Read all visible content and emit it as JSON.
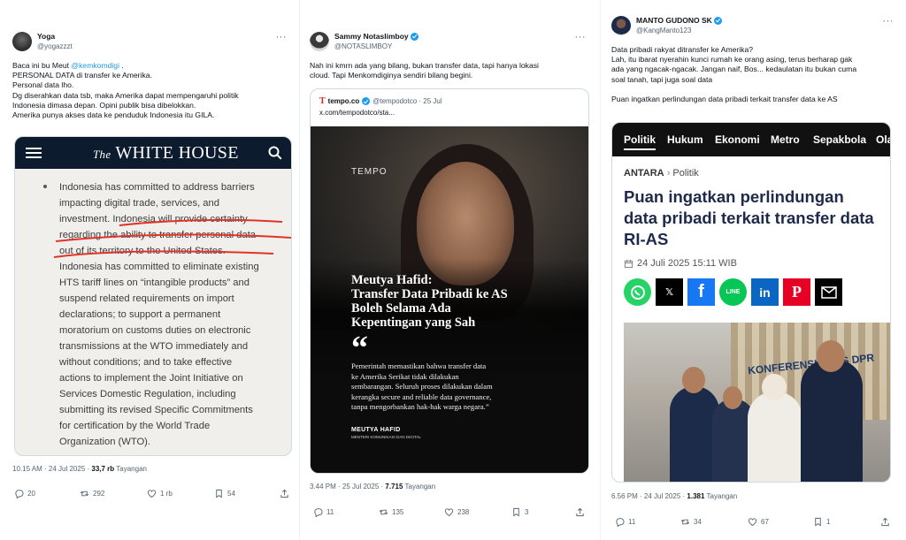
{
  "tweets": [
    {
      "name": "Yoga",
      "handle": "@yogazzzt",
      "lines": [
        {
          "pre": "Baca ini bu Meut ",
          "mention": "@kemkomdigi",
          "post": " ."
        },
        {
          "pre": "PERSONAL DATA di transfer ke Amerika."
        },
        {
          "pre": "Personal data lho."
        },
        {
          "pre": "Dg diserahkan data tsb, maka Amerika dapat mempengaruhi politik"
        },
        {
          "pre": "Indonesia dimasa depan. Opini publik bisa dibelokkan."
        },
        {
          "pre": "Amerika punya akses data ke penduduk Indonesia itu GILA."
        }
      ],
      "card": {
        "site_title_prefix": "The",
        "site_title": "WHITE HOUSE",
        "body_lines": [
          "Indonesia has committed to address barriers",
          "impacting digital trade, services, and",
          "investment.  Indonesia will provide certainty",
          "regarding the ability to transfer personal data",
          "out of its territory to the United States.",
          "Indonesia has committed to eliminate existing",
          "HTS tariff lines on “intangible products” and",
          "suspend related requirements on import",
          "declarations; to support a permanent",
          "moratorium on customs duties on electronic",
          "transmissions at the WTO immediately and",
          "without conditions; and to take effective",
          "actions to implement the Joint Initiative on",
          "Services Domestic Regulation, including",
          "submitting its revised Specific Commitments",
          "for certification by the World Trade",
          "Organization (WTO)."
        ]
      },
      "time": "10.15 AM · 24 Jul 2025 · ",
      "views": "33,7 rb",
      "views_label": " Tayangan",
      "replies": "20",
      "reposts": "292",
      "likes": "1 rb",
      "bookmarks": "54"
    },
    {
      "name": "Sammy Notaslimboy",
      "handle": "@NOTASLIMBOY",
      "lines": [
        {
          "pre": "Nah ini kmrn ada yang bilang, bukan transfer data, tapi hanya lokasi"
        },
        {
          "pre": "cloud. Tapi Menkomdiginya sendiri bilang begini."
        }
      ],
      "quote": {
        "name": "tempo.co",
        "handle": "@tempodotco · 25 Jul",
        "url": "x.com/tempodotco/sta...",
        "logo": "TEMPO",
        "headline": [
          "Meutya Hafid:",
          "Transfer Data Pribadi ke AS",
          "Boleh Selama Ada",
          "Kepentingan yang Sah"
        ],
        "quote_mark": "“",
        "quote_lines": [
          "Pemerintah memastikan bahwa transfer data",
          "ke Amerika Serikat tidak dilakukan",
          "sembarangan. Seluruh proses dilakukan dalam",
          "kerangka secure and reliable data governance,",
          "tanpa mengorbankan hak-hak warga negara.”"
        ],
        "speaker": "MEUTYA HAFID",
        "speaker_role": "MENTERI KOMUNIKASI DAN DIGITAL"
      },
      "time": "3.44 PM · 25 Jul 2025 · ",
      "views": "7.715",
      "views_label": " Tayangan",
      "replies": "11",
      "reposts": "135",
      "likes": "238",
      "bookmarks": "3"
    },
    {
      "name": "MANTO GUDONO SK",
      "handle": "@KangManto123",
      "lines": [
        {
          "pre": "Data pribadi rakyat ditransfer ke Amerika?"
        },
        {
          "pre": "Lah, itu ibarat nyerahin kunci rumah ke orang asing, terus berharap gak"
        },
        {
          "pre": "ada yang ngacak-ngacak. Jangan naif, Bos... kedaulatan itu bukan cuma"
        },
        {
          "pre": "soal tanah, tapi juga soal data"
        },
        {
          "pre": ""
        },
        {
          "pre": "Puan ingatkan perlindungan data pribadi terkait transfer data ke AS"
        }
      ],
      "article": {
        "nav": [
          "Politik",
          "Hukum",
          "Ekonomi",
          "Metro",
          "Sepakbola",
          "Ola"
        ],
        "source": "ANTARA",
        "section": "Politik",
        "title_lines": [
          "Puan ingatkan perlindungan",
          "data pribadi terkait transfer data",
          "RI-AS"
        ],
        "date": "24 Juli 2025 15:11 WIB",
        "wall_text": "KONFERENSI PERS DPR"
      },
      "time": "6.56 PM · 24 Jul 2025 · ",
      "views": "1.381",
      "views_label": " Tayangan",
      "replies": "11",
      "reposts": "34",
      "likes": "67",
      "bookmarks": "1"
    }
  ]
}
